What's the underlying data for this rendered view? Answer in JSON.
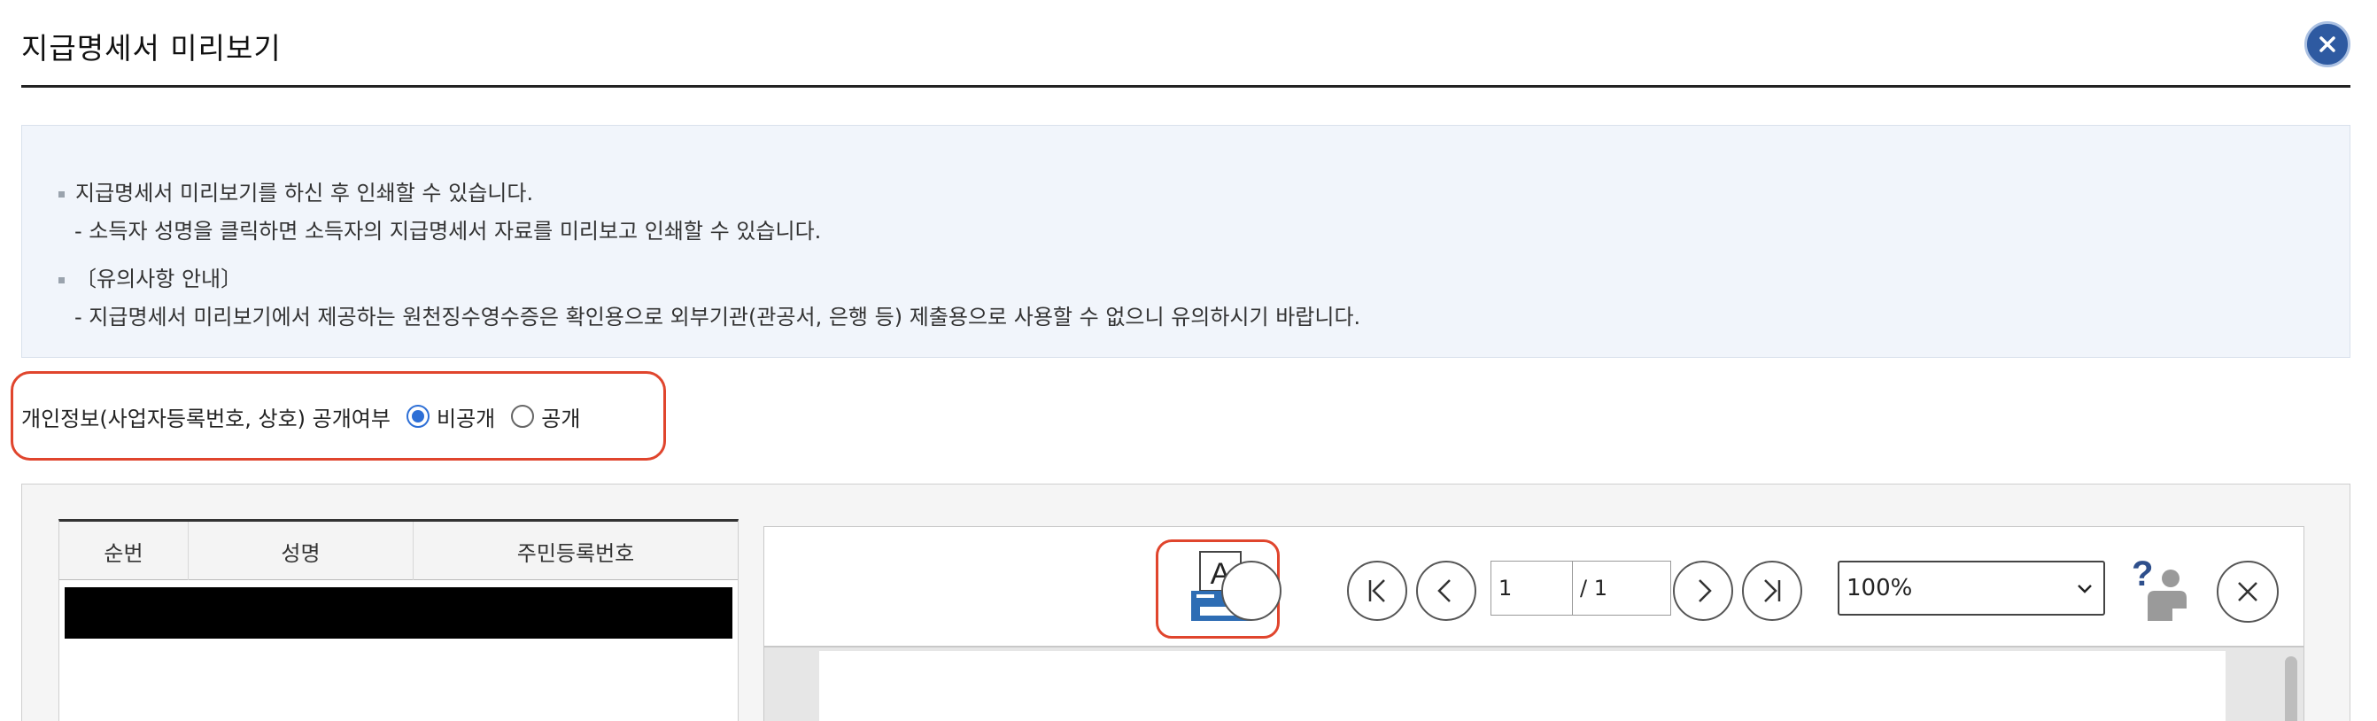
{
  "dialog": {
    "title": "지급명세서 미리보기",
    "close_icon": "close-icon",
    "accent_color": "#2e5aa1"
  },
  "info": {
    "line1": "지급명세서 미리보기를 하신 후 인쇄할 수 있습니다.",
    "line2": "- 소득자 성명을 클릭하면 소득자의 지급명세서 자료를 미리보고 인쇄할 수 있습니다.",
    "line3": "〔유의사항 안내〕",
    "line4": "- 지급명세서 미리보기에서 제공하는 원천징수영수증은 확인용으로 외부기관(관공서, 은행 등) 제출용으로 사용할 수 없으니 유의하시기 바랍니다."
  },
  "privacy": {
    "label": "개인정보(사업자등록번호, 상호) 공개여부",
    "option_private": "비공개",
    "option_public": "공개",
    "selected": "비공개",
    "highlight_color": "#e0452d"
  },
  "table": {
    "headers": [
      "순번",
      "성명",
      "주민등록번호"
    ]
  },
  "viewer": {
    "print_icon": "print-icon",
    "first_icon": "first-page-icon",
    "prev_icon": "prev-page-icon",
    "next_icon": "next-page-icon",
    "last_icon": "last-page-icon",
    "current_page": "1",
    "total_pages": "/ 1",
    "zoom": "100%",
    "help_icon": "help-icon",
    "close_icon": "close-icon"
  }
}
